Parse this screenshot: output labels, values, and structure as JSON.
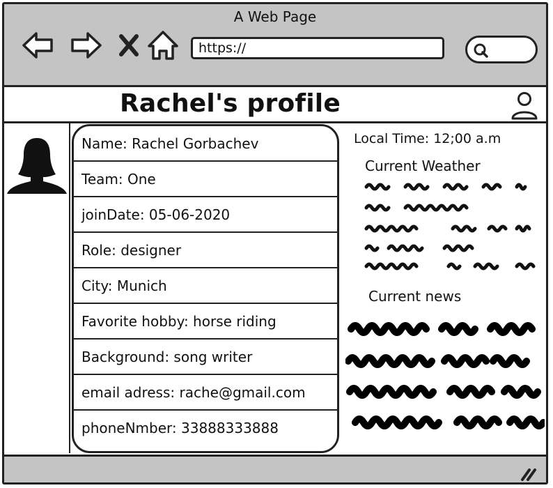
{
  "window": {
    "title": "A Web Page"
  },
  "browser": {
    "url": "https://",
    "icons": [
      "back-arrow-icon",
      "forward-arrow-icon",
      "close-x-icon",
      "home-icon",
      "search-icon"
    ]
  },
  "page": {
    "title": "Rachel's profile",
    "user_icon": "user-icon"
  },
  "profile": {
    "avatar": "person-silhouette",
    "fields": [
      "Name: Rachel Gorbachev",
      "Team:  One",
      "joinDate: 05-06-2020",
      "Role: designer",
      "City: Munich",
      "Favorite hobby: horse riding",
      "Background: song writer",
      "email adress: rache@gmail.com",
      "phoneNmber: 33888333888"
    ]
  },
  "side": {
    "local_time": "Local Time: 12;00 a.m",
    "weather_title": "Current Weather",
    "news_title": "Current news"
  },
  "colors": {
    "chrome": "#c4c4c4",
    "ink": "#222222",
    "background": "#ffffff"
  }
}
